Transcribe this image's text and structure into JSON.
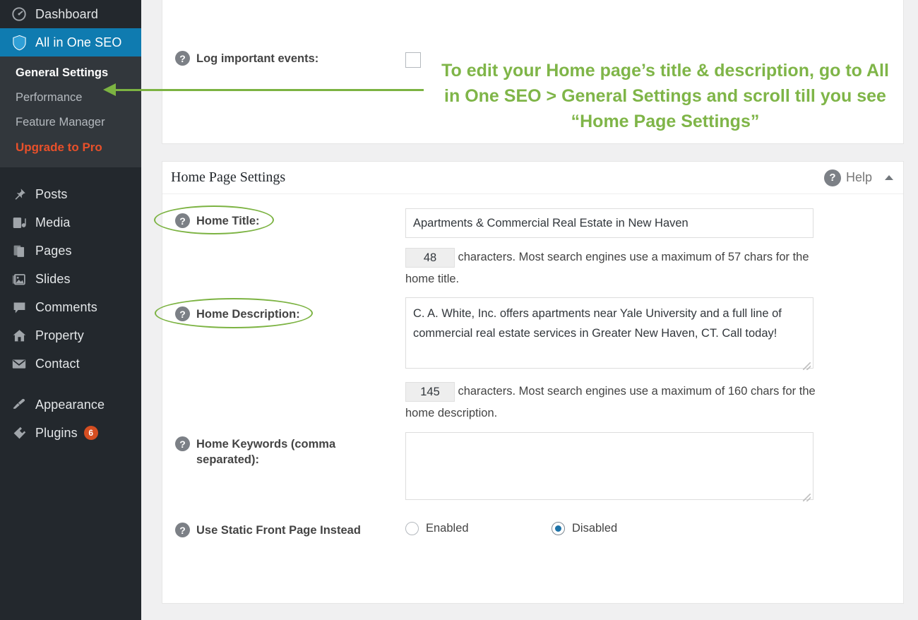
{
  "sidebar": {
    "items": [
      {
        "label": "Dashboard",
        "icon": "dashboard-icon",
        "name": "dashboard"
      },
      {
        "label": "All in One SEO",
        "icon": "shield-icon",
        "name": "all-in-one-seo",
        "active": true
      },
      {
        "label": "Posts",
        "icon": "pin-icon",
        "name": "posts"
      },
      {
        "label": "Media",
        "icon": "media-icon",
        "name": "media"
      },
      {
        "label": "Pages",
        "icon": "pages-icon",
        "name": "pages"
      },
      {
        "label": "Slides",
        "icon": "slides-icon",
        "name": "slides"
      },
      {
        "label": "Comments",
        "icon": "comment-icon",
        "name": "comments"
      },
      {
        "label": "Property",
        "icon": "home-icon",
        "name": "property"
      },
      {
        "label": "Contact",
        "icon": "envelope-icon",
        "name": "contact"
      },
      {
        "label": "Appearance",
        "icon": "brush-icon",
        "name": "appearance"
      },
      {
        "label": "Plugins",
        "icon": "plug-icon",
        "name": "plugins",
        "badge": "6"
      }
    ],
    "submenu": [
      {
        "label": "General Settings",
        "current": true
      },
      {
        "label": "Performance",
        "current": false
      },
      {
        "label": "Feature Manager",
        "current": false
      },
      {
        "label": "Upgrade to Pro",
        "current": false,
        "pro": true
      }
    ]
  },
  "top_panel": {
    "log_events_label": "Log important events:",
    "log_events_checked": false
  },
  "annotation": {
    "text": "To edit your Home page’s title & description, go to All in One SEO > General Settings and scroll till you see “Home Page Settings”",
    "color": "#7fb548"
  },
  "home_panel": {
    "title": "Home Page Settings",
    "help_label": "Help",
    "fields": {
      "home_title": {
        "label": "Home Title:",
        "value": "Apartments & Commercial Real Estate in New Haven",
        "count": "48",
        "hint": "characters. Most search engines use a maximum of 57 chars for the home title."
      },
      "home_description": {
        "label": "Home Description:",
        "value": "C. A. White, Inc. offers apartments near Yale University and a full line of commercial real estate services in Greater New Haven, CT. Call today!",
        "count": "145",
        "hint": "characters. Most search engines use a maximum of 160 chars for the home description."
      },
      "home_keywords": {
        "label": "Home Keywords (comma separated):",
        "value": ""
      },
      "static_front_page": {
        "label": "Use Static Front Page Instead",
        "options": [
          {
            "label": "Enabled",
            "selected": false
          },
          {
            "label": "Disabled",
            "selected": true
          }
        ]
      }
    }
  },
  "colors": {
    "sidebar_bg": "#23282d",
    "submenu_bg": "#32373c",
    "active_blue": "#0f7bb0",
    "pro_orange": "#e8502a",
    "annotation_green": "#7fb548",
    "badge_red": "#d54e21"
  }
}
